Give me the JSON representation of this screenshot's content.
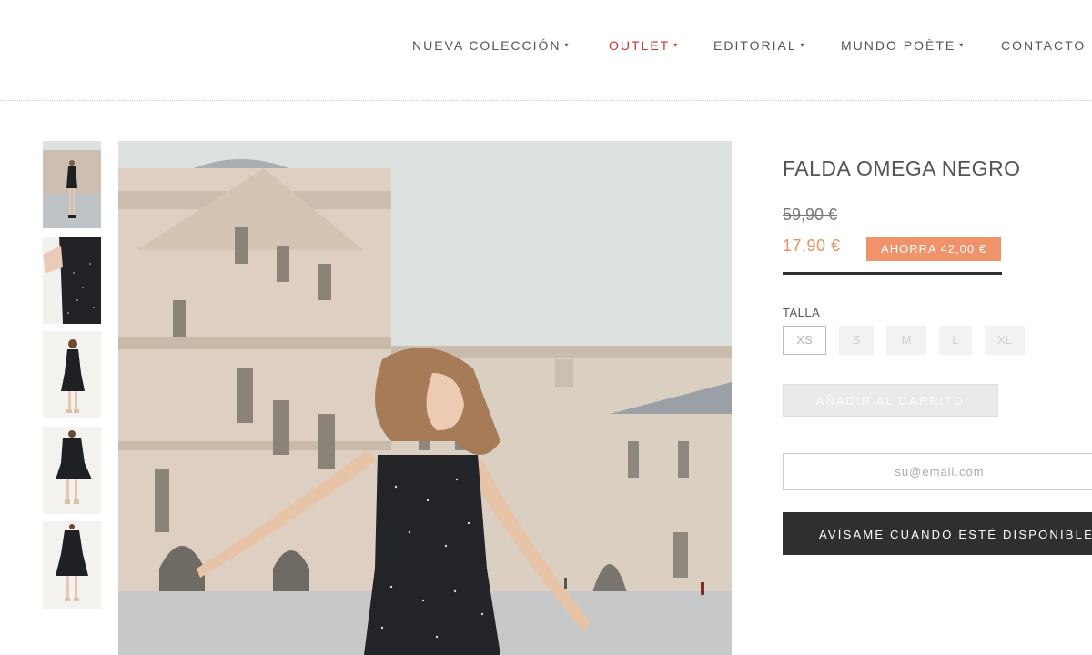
{
  "nav": {
    "items": [
      {
        "label": "NUEVA COLECCIÓN",
        "caret": "▾"
      },
      {
        "label": "OUTLET",
        "caret": "▾"
      },
      {
        "label": "EDITORIAL",
        "caret": "▾"
      },
      {
        "label": "MUNDO POÈTE",
        "caret": "▾"
      },
      {
        "label": "CONTACTO",
        "caret": ""
      }
    ]
  },
  "product": {
    "title": "FALDA OMEGA NEGRO",
    "old_price": "59,90 €",
    "new_price": "17,90 €",
    "save_badge": "AHORRA 42,00 €",
    "size_label": "TALLA",
    "sizes": [
      {
        "label": "XS",
        "selected": true
      },
      {
        "label": "S",
        "selected": false
      },
      {
        "label": "M",
        "selected": false
      },
      {
        "label": "L",
        "selected": false
      },
      {
        "label": "XL",
        "selected": false
      }
    ],
    "add_to_cart": "AÑADIR AL CARRITO",
    "email_placeholder": "su@email.com",
    "notify_button": "AVÍSAME CUANDO ESTÉ DISPONIBLE"
  },
  "colors": {
    "accent_red": "#c9372c",
    "price_orange": "#e8935f",
    "badge_orange": "#f0926a",
    "dark_button": "#2f2f2f"
  }
}
